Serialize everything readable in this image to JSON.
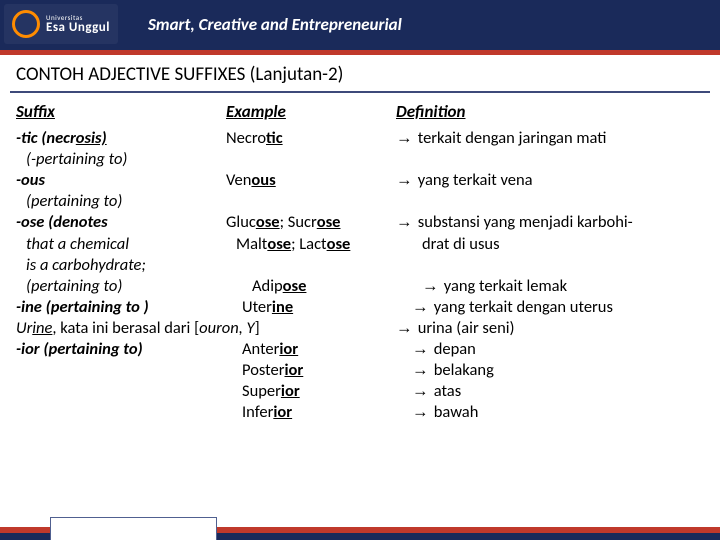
{
  "brand": {
    "small": "Universitas",
    "big": "Esa Unggul",
    "tagline": "Smart, Creative and Entrepreneurial"
  },
  "title": "CONTOH  ADJECTIVE SUFFIXES (Lanjutan-2)",
  "head": {
    "suffix": "Suffix",
    "example": "Example",
    "definition": "Definition"
  },
  "r1": {
    "suf": "-tic (necr",
    "suf_u": "osis)",
    "ex_a": "Necro",
    "ex_u": "tic",
    "def": "terkait dengan jaringan mati"
  },
  "r1b": {
    "suf": "(-pertaining to)"
  },
  "r2": {
    "suf": "-ous",
    "ex_a": "Ven",
    "ex_u": "ous",
    "def": "yang terkait vena"
  },
  "r2b": {
    "suf": "(pertaining to)"
  },
  "r3": {
    "suf": "-ose (denotes",
    "ex_a": "Gluc",
    "ex_u1": "ose",
    "sep": "; Sucr",
    "ex_u2": "ose",
    "def": "substansi yang menjadi karbohi-"
  },
  "r4": {
    "suf": "that a chemical",
    "ex_a": "Malt",
    "ex_u1": "ose",
    "sep": "; Lact",
    "ex_u2": "ose",
    "def": "drat di usus"
  },
  "r5": {
    "suf": "is a carbohydrate;"
  },
  "r6": {
    "suf": "(pertaining to)",
    "ex_a": "Adip",
    "ex_u": "ose",
    "def": "yang terkait lemak"
  },
  "r7": {
    "suf": "-ine (pertaining to )",
    "ex_a": "Uter",
    "ex_u": "ine",
    "def": "yang terkait dengan uterus"
  },
  "r8": {
    "left_a": "Ur",
    "left_u": "ine",
    "left_b": ", kata ini berasal dari [",
    "left_c": "ouron, Y",
    "left_d": "]",
    "def": "urina (air seni)"
  },
  "r9": {
    "suf": "-ior (pertaining to)",
    "ex_a": "Anter",
    "ex_u": "ior",
    "def": "depan"
  },
  "r10": {
    "ex_a": "Poster",
    "ex_u": "ior",
    "def": "belakang"
  },
  "r11": {
    "ex_a": "Super",
    "ex_u": "ior",
    "def": "atas"
  },
  "r12": {
    "ex_a": "Infer",
    "ex_u": "ior",
    "def": "bawah"
  },
  "arrow": "→"
}
